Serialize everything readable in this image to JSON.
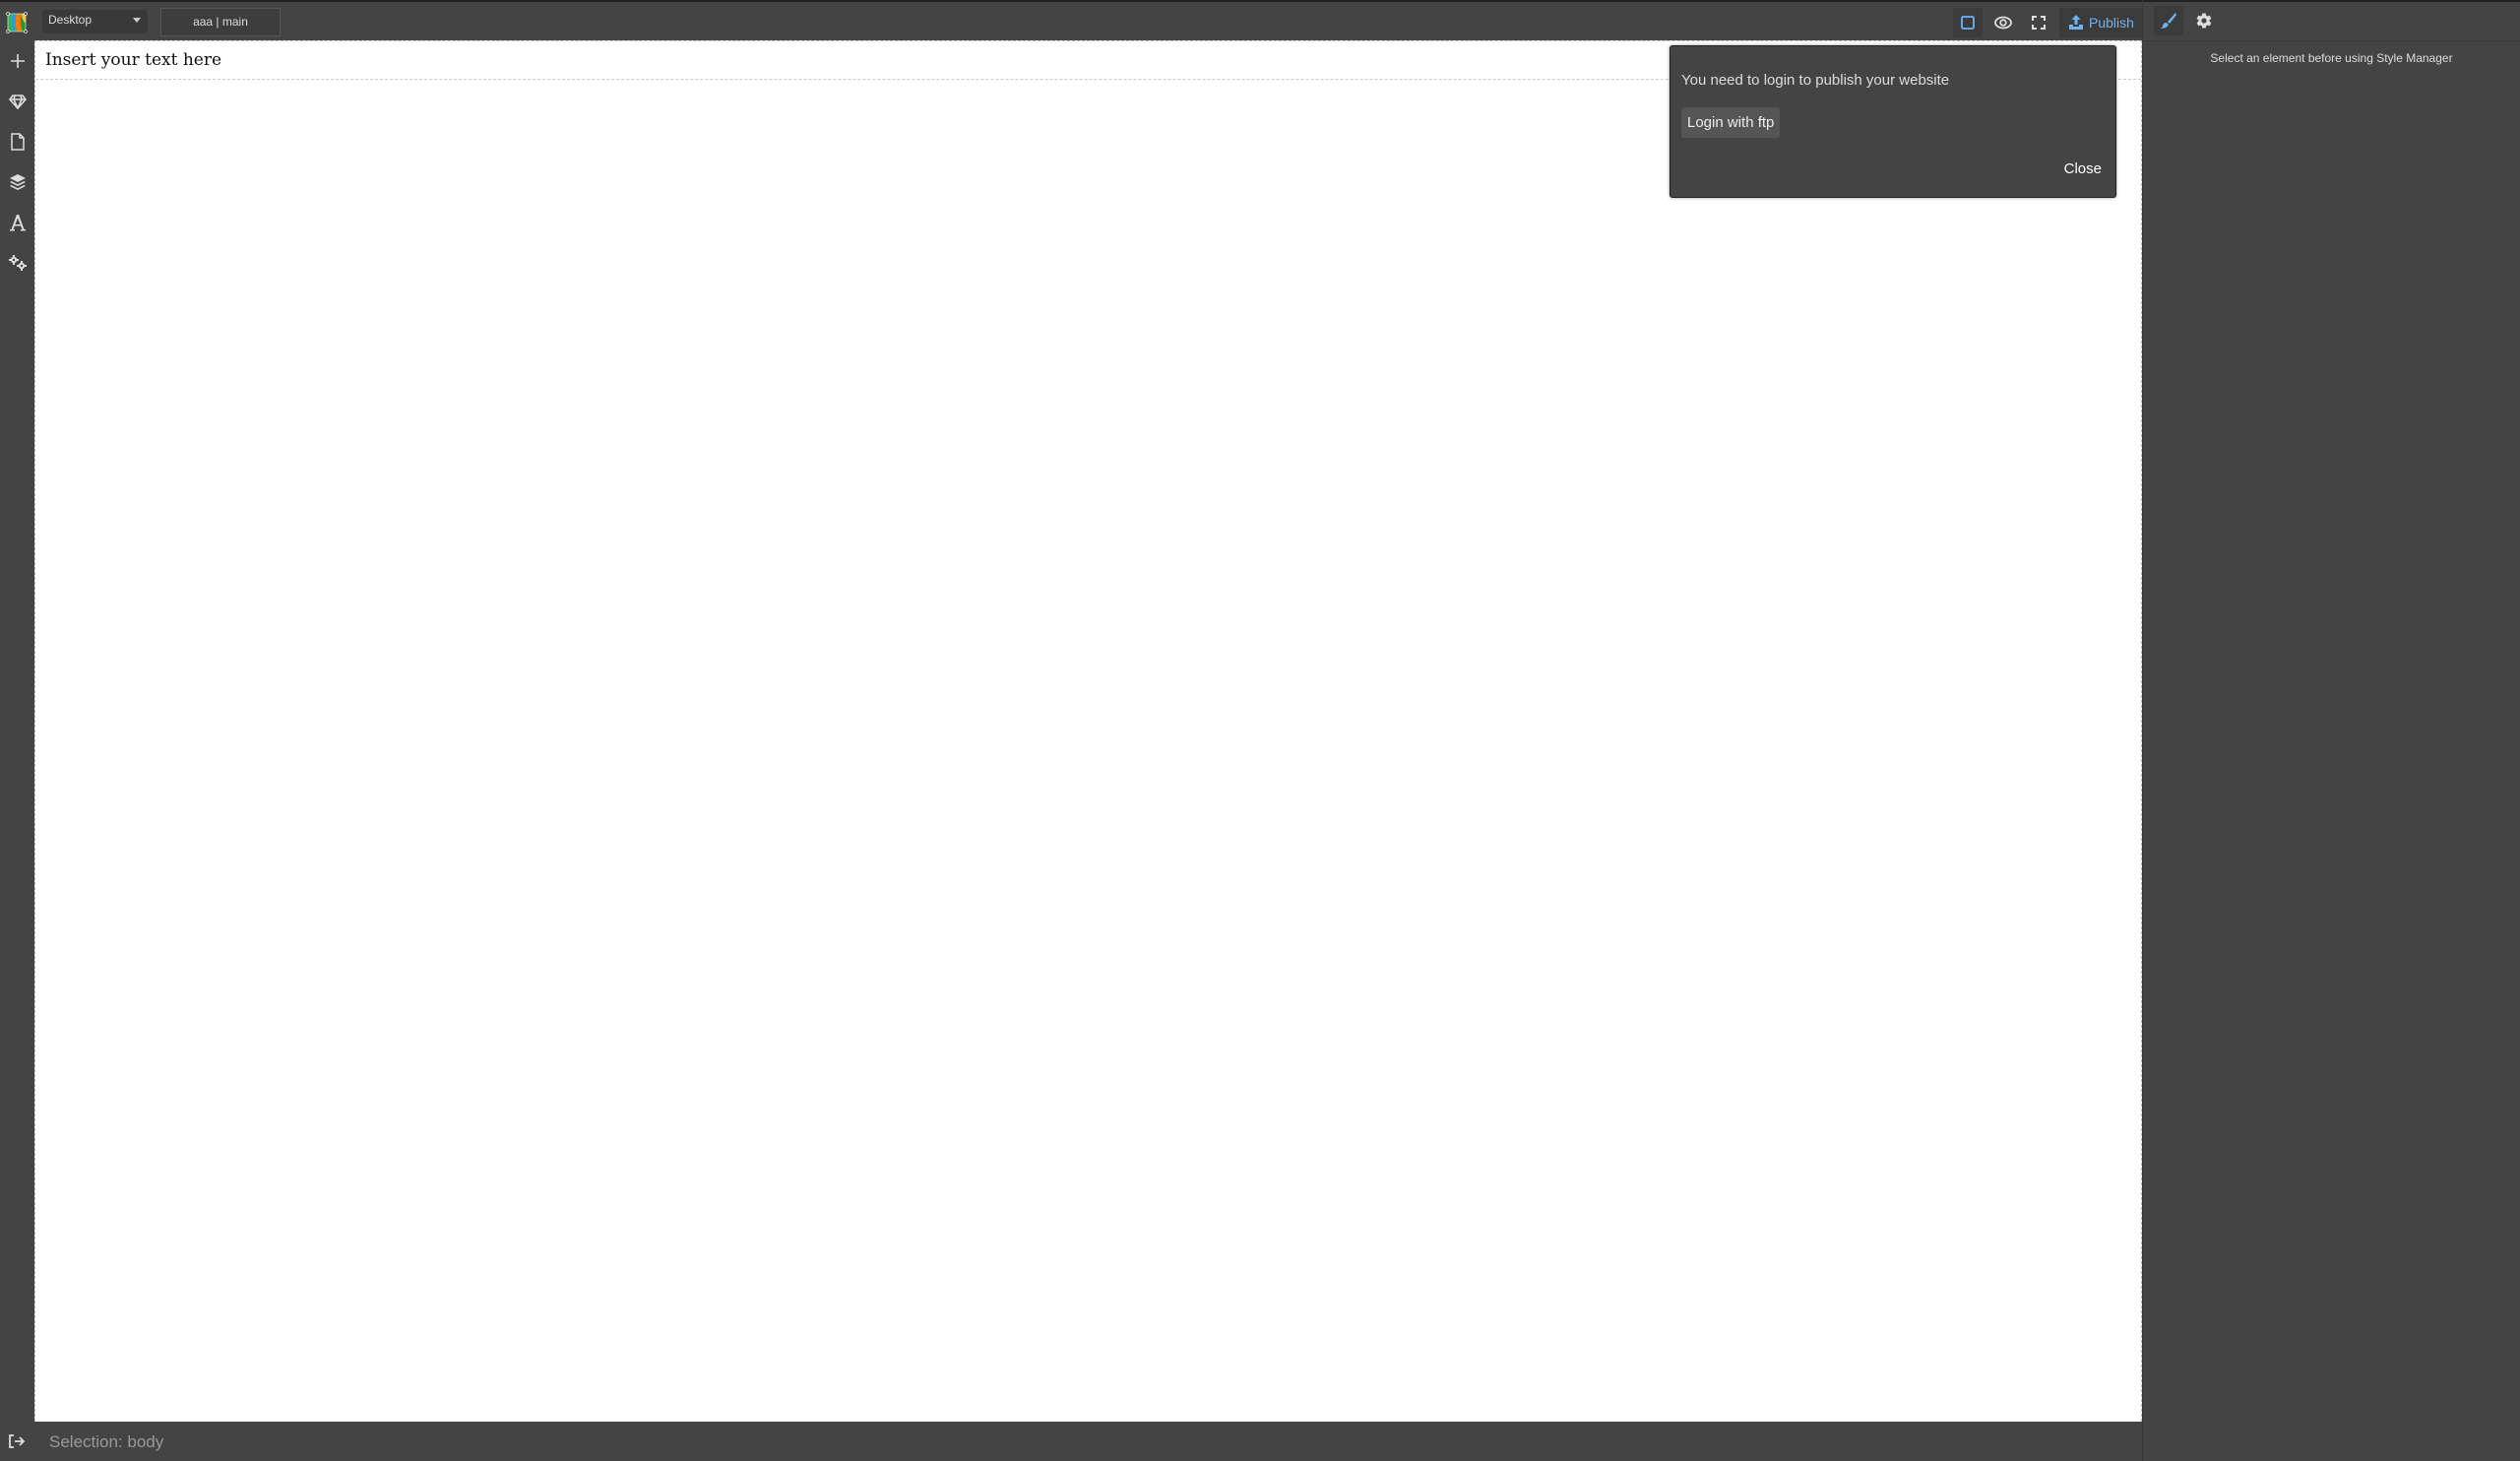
{
  "app": {
    "logo": "grapesjs-logo-icon"
  },
  "topbar": {
    "device_selected": "Desktop",
    "page_title": "aaa | main",
    "buttons": {
      "border_toggle": "square-icon",
      "preview": "eye-icon",
      "fullscreen": "fullscreen-icon",
      "publish_label": "Publish",
      "publish_icon": "upload-icon"
    },
    "accent_color": "#6eb3f2"
  },
  "panel_tabs": {
    "style_manager": "paint-brush-icon",
    "settings": "gear-icon"
  },
  "left_bar": {
    "items": [
      {
        "name": "add-block",
        "icon": "plus-icon"
      },
      {
        "name": "symbols",
        "icon": "diamond-icon"
      },
      {
        "name": "pages",
        "icon": "file-icon"
      },
      {
        "name": "layers",
        "icon": "layers-icon"
      },
      {
        "name": "fonts",
        "icon": "font-icon"
      },
      {
        "name": "settings",
        "icon": "cogs-icon"
      }
    ]
  },
  "canvas": {
    "text_block": "Insert your text here"
  },
  "right_panel": {
    "message": "Select an element before using Style Manager"
  },
  "statusbar": {
    "selection_label": "Selection:  body",
    "exit_icon": "sign-out-icon"
  },
  "modal": {
    "message": "You need to login to publish your website",
    "login_button": "Login with ftp",
    "close_button": "Close"
  }
}
